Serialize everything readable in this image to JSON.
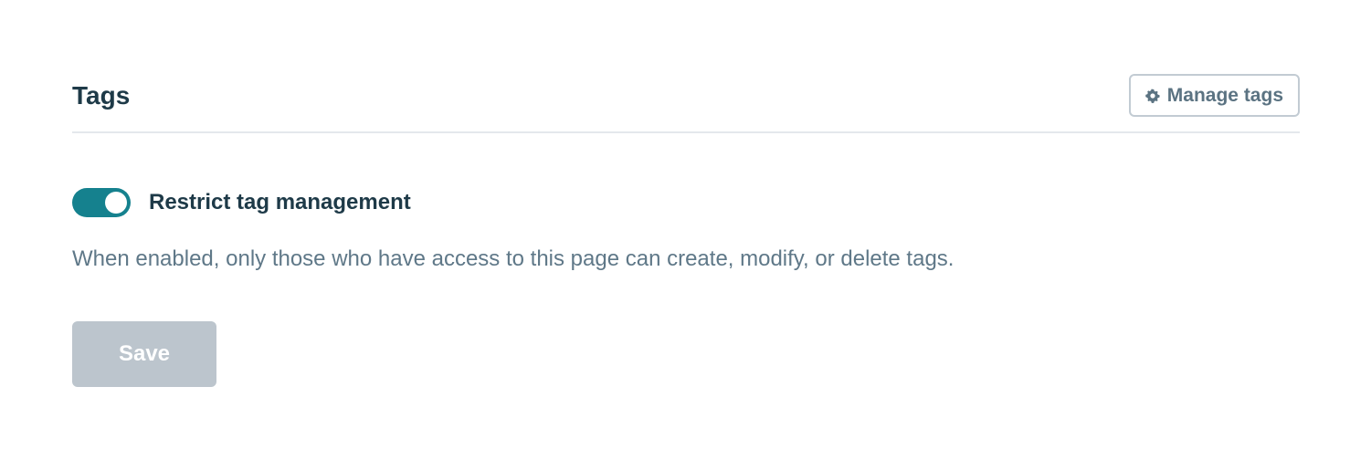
{
  "section": {
    "title": "Tags",
    "manage_tags_label": "Manage tags",
    "manage_tags_icon": "gear-icon"
  },
  "restrict_toggle": {
    "label": "Restrict tag management",
    "enabled": true,
    "color_on": "#15818e",
    "description": "When enabled, only those who have access to this page can create, modify, or delete tags."
  },
  "actions": {
    "save_label": "Save",
    "save_disabled": true
  }
}
